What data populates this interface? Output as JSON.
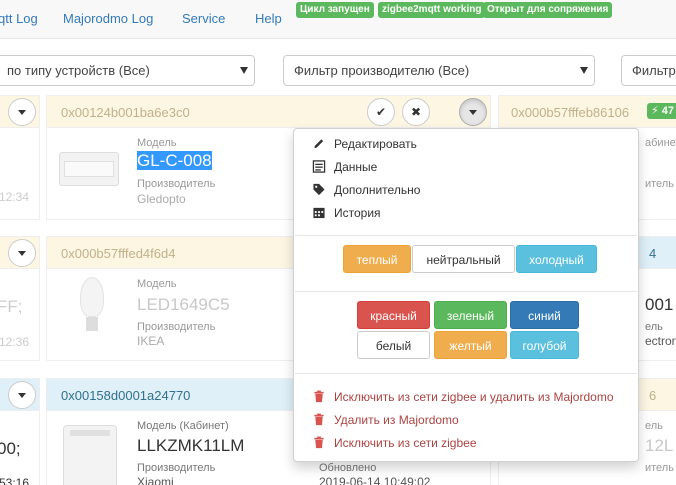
{
  "nav": {
    "links": [
      "qtt Log",
      "Majorodmo Log",
      "Service",
      "Help"
    ],
    "badges": [
      "Цикл запущен",
      "zigbee2mqtt working",
      "Открыт для сопряжения"
    ]
  },
  "filters": {
    "type": "по типу устройств (Все)",
    "vendor": "Фильтр производителю (Все)",
    "third": "Фильтр"
  },
  "cards": {
    "left1": {
      "time": "12:34"
    },
    "left2": {
      "value": "FF;",
      "time": "12:36"
    },
    "left3": {
      "value": "00;",
      "time": "53:16"
    },
    "main1": {
      "address": "0x00124b001ba6e3c0",
      "model_label": "Модель",
      "model": "GL-C-008",
      "vendor_label": "Производитель",
      "vendor": "Gledopto"
    },
    "main2": {
      "address": "0x000b57fffed4f6d4",
      "model_label": "Модель",
      "model": "LED1649C5",
      "vendor_label": "Производитель",
      "vendor": "IKEA"
    },
    "main3": {
      "address": "0x00158d0001a24770",
      "model_label": "Модель (Кабинет)",
      "model": "LLKZMK11LM",
      "vendor_label": "Производитель",
      "vendor": "Xiaomi",
      "updated_label": "Обновлено",
      "updated": "2019-06-14 10:49:02"
    },
    "right1": {
      "address": "0x000b57fffeb86106",
      "badge": "47",
      "label": "абинет",
      "sub": "ель",
      "sub2": "итель"
    },
    "right2": {
      "address": "4",
      "value": "001",
      "sub": "ель",
      "vendor": "ectron"
    },
    "right3": {
      "address": "6",
      "value": "12L",
      "sub": "ель",
      "sub2": "итель"
    }
  },
  "menu": {
    "items": [
      "Редактировать",
      "Данные",
      "Дополнительно",
      "История"
    ],
    "temps": [
      "теплый",
      "нейтральный",
      "холодный"
    ],
    "colors": [
      "красный",
      "зеленый",
      "синий",
      "белый",
      "желтый",
      "голубой"
    ],
    "actions": [
      "Исключить из сети zigbee и удалить из Majordomo",
      "Удалить из Majordomo",
      "Исключить из сети zigbee"
    ]
  },
  "colors": {
    "accent": "#337ab7",
    "success": "#5cb85c",
    "warning": "#f0ad4e",
    "info": "#5bc0de",
    "danger": "#d9534f"
  }
}
